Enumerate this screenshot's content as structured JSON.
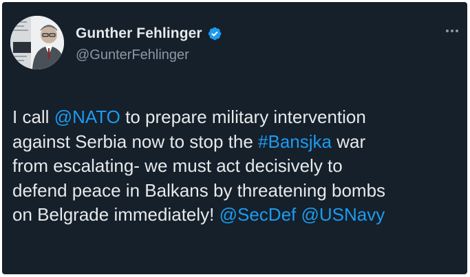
{
  "author": {
    "display_name": "Gunther Fehlinger",
    "handle": "@GunterFehlinger",
    "verified": true,
    "avatar_icon": "profile-photo-icon",
    "verified_icon": "verified-badge-icon"
  },
  "menu": {
    "more_icon": "more-horizontal-icon"
  },
  "tweet": {
    "lines": [
      [
        {
          "text": "I call ",
          "link": false
        },
        {
          "text": "@NATO",
          "link": true
        },
        {
          "text": " to prepare military intervention",
          "link": false
        }
      ],
      [
        {
          "text": "against Serbia now to stop the ",
          "link": false
        },
        {
          "text": "#Bansjka",
          "link": true
        },
        {
          "text": " war",
          "link": false
        }
      ],
      [
        {
          "text": "from escalating- we must act decisively to",
          "link": false
        }
      ],
      [
        {
          "text": "defend peace in Balkans by threatening bombs",
          "link": false
        }
      ],
      [
        {
          "text": "on Belgrade immediately! ",
          "link": false
        },
        {
          "text": "@SecDef",
          "link": true
        },
        {
          "text": " ",
          "link": false
        },
        {
          "text": "@USNavy",
          "link": true
        }
      ]
    ]
  },
  "colors": {
    "background": "#15202b",
    "text": "#e7e9ea",
    "secondary_text": "#8b98a5",
    "link": "#1d9bf0"
  }
}
